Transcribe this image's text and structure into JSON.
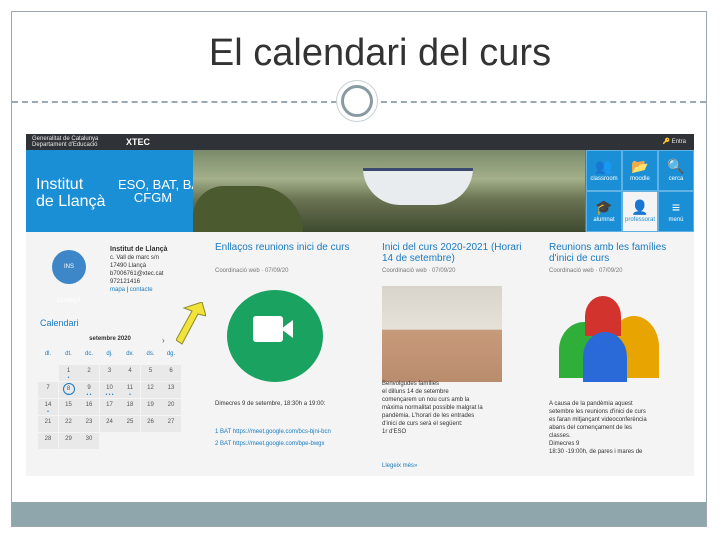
{
  "slide": {
    "title": "El calendari del curs"
  },
  "header": {
    "gencat": "Generalitat de Catalunya\nDepartament d'Educació",
    "xtec": "XTEC",
    "entra": "Entra"
  },
  "banner": {
    "institute": "Institut\nde Llançà",
    "studies": "ESO, BAT, BAC,\nCFGM"
  },
  "tiles": [
    {
      "icon": "users-icon",
      "glyph": "👥",
      "label": "classroom"
    },
    {
      "icon": "folder-icon",
      "glyph": "📂",
      "label": "moodle"
    },
    {
      "icon": "search-icon",
      "glyph": "🔍",
      "label": "cerca"
    },
    {
      "icon": "graduation-icon",
      "glyph": "🎓",
      "label": "alumnat"
    },
    {
      "icon": "teacher-icon",
      "glyph": "👤",
      "label": "professorat"
    },
    {
      "icon": "menu-icon",
      "glyph": "≡",
      "label": "menú"
    }
  ],
  "school": {
    "name": "Institut de Llançà",
    "address": "c. Vall de marc s/n\n17490 Llançà",
    "email": "b7006761@xtec.cat",
    "phone": "972121416",
    "link_map": "mapa",
    "link_contact": "contacte",
    "logo_text": "INS LLANÇÀ"
  },
  "calendar": {
    "title": "Calendari",
    "month": "setembre 2020",
    "next": "›",
    "weekdays": [
      "dl.",
      "dt.",
      "dc.",
      "dj.",
      "dv.",
      "ds.",
      "dg."
    ],
    "weeks": [
      [
        "",
        "1",
        "2",
        "3",
        "4",
        "5",
        "6"
      ],
      [
        "7",
        "8",
        "9",
        "10",
        "11",
        "12",
        "13"
      ],
      [
        "14",
        "15",
        "16",
        "17",
        "18",
        "19",
        "20"
      ],
      [
        "21",
        "22",
        "23",
        "24",
        "25",
        "26",
        "27"
      ],
      [
        "28",
        "29",
        "30",
        "",
        "",
        "",
        ""
      ]
    ],
    "today": "8"
  },
  "posts": [
    {
      "title": "Enllaços reunions inici de curs",
      "author": "Coordinació web",
      "date": "07/09/20",
      "text": "Dimecres 9 de setembre, 18:30h a 19:00:",
      "bullets": [
        "1 BAT https://meet.google.com/bcs-bjni-bcn",
        "2 BAT https://meet.google.com/bpe-bwgx"
      ]
    },
    {
      "title": "Inici del curs 2020-2021 (Horari 14 de setembre)",
      "author": "Coordinació web",
      "date": "07/09/20",
      "text": "Benvolgudes famílies\nel dilluns 14 de setembre\ncomençarem un nou curs amb la\nmàxima normalitat possible malgrat la\npandèmia. L'horari de les entrades\nd'inici de curs serà el següent:\n1r d'ESO",
      "more": "Llegeix més»"
    },
    {
      "title": "Reunions amb les famílies d'inici de curs",
      "author": "Coordinació web",
      "date": "07/09/20",
      "text": "A causa de la pandèmia aquest\nsetembre les reunions d'inici de curs\nes faran mitjançant videoconferència\nabans del començament de les\nclasses.\nDimecres 9\n18:30 -19:00h, de pares i mares de"
    }
  ]
}
